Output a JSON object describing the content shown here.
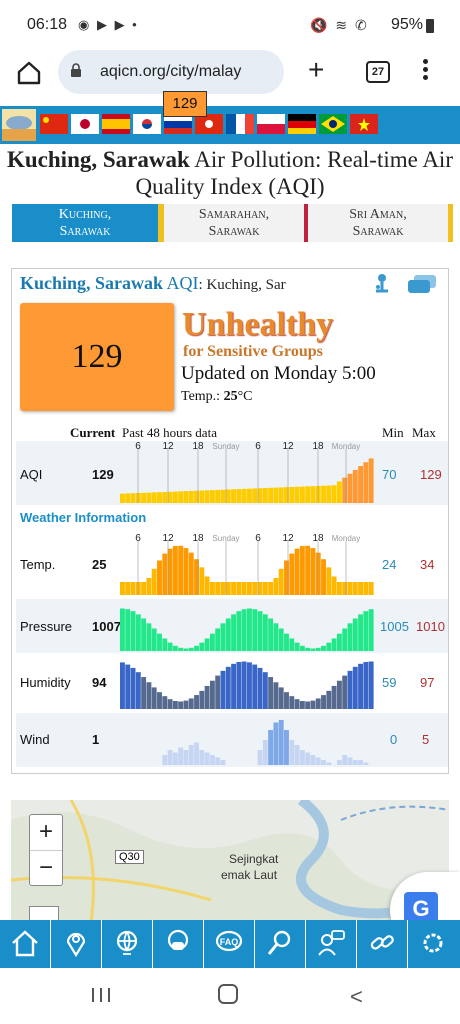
{
  "status_bar": {
    "time": "06:18",
    "notif_icons": "◉ ▶ ▶ •",
    "right_icons": "🔇 ≋ ✆ ",
    "battery": "95%"
  },
  "browser": {
    "url": "aqicn.org/city/malay",
    "tab_count": "27"
  },
  "title": {
    "bold": "Kuching, Sarawak",
    "rest": " Air Pollution: Real-time Air Quality Index (AQI)"
  },
  "city_tabs": [
    {
      "line1": "Kuching,",
      "line2": "Sarawak"
    },
    {
      "line1": "Samarahan,",
      "line2": "Sarawak"
    },
    {
      "line1": "Sri Aman,",
      "line2": "Sarawak"
    }
  ],
  "card": {
    "title": "Kuching, Sarawak",
    "title_aqi": " AQI",
    "title_sub": ": Kuching, Sar",
    "aqi_value": "129",
    "status_main": "Unhealthy",
    "status_sub": "for Sensitive Groups",
    "updated": "Updated on Monday 5:00",
    "temp_label": "Temp.: ",
    "temp_value": "25",
    "temp_unit": "°C",
    "header_current": "Current",
    "header_past": "Past 48 hours data",
    "header_min": "Min",
    "header_max": "Max",
    "weather_info": "Weather Information",
    "time_ticks": [
      "6",
      "12",
      "18",
      "Sunday",
      "6",
      "12",
      "18",
      "Monday"
    ]
  },
  "rows": [
    {
      "label": "AQI",
      "value": "129",
      "min": "70",
      "max": "129"
    },
    {
      "label": "Temp.",
      "value": "25",
      "min": "24",
      "max": "34"
    },
    {
      "label": "Pressure",
      "value": "1007",
      "min": "1005",
      "max": "1010"
    },
    {
      "label": "Humidity",
      "value": "94",
      "min": "59",
      "max": "97"
    },
    {
      "label": "Wind",
      "value": "1",
      "min": "0",
      "max": "5"
    }
  ],
  "map": {
    "zoom_in": "+",
    "zoom_out": "−",
    "road_label": "Q30",
    "place1": "Sejingkat",
    "place2": "emak Laut",
    "marker_value": "129"
  },
  "toolbar_icons": [
    "home-icon",
    "location-icon",
    "globe-icon",
    "mask-icon",
    "faq-icon",
    "search-icon",
    "contact-icon",
    "link-icon",
    "settings-icon"
  ],
  "colors": {
    "brand_blue": "#1a8ec9",
    "aqi_orange": "#ff9933",
    "min_color": "#2a8ab8",
    "max_color": "#b03030"
  }
}
